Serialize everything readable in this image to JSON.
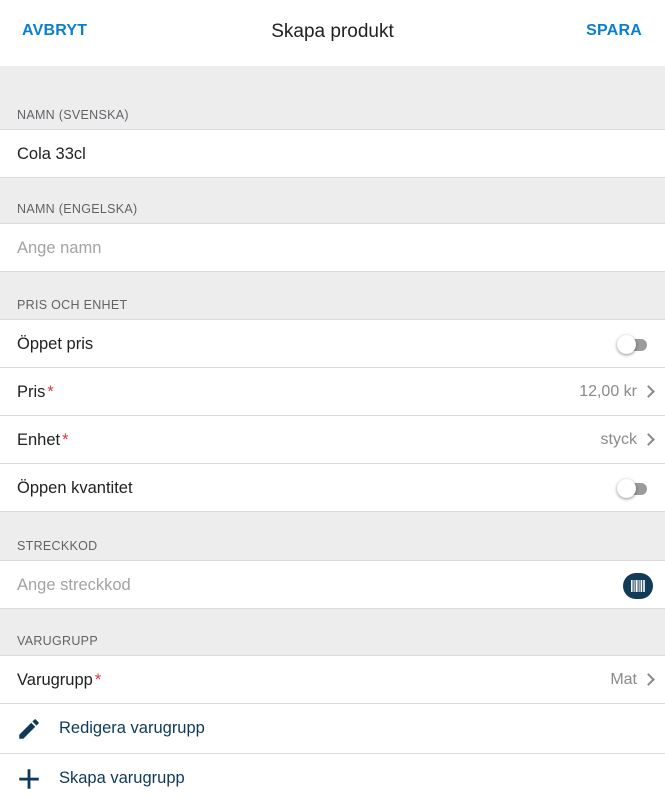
{
  "header": {
    "cancel_label": "AVBRYT",
    "title": "Skapa produkt",
    "save_label": "SPARA"
  },
  "sections": {
    "name_sv": {
      "header": "NAMN (SVENSKA)",
      "value": "Cola 33cl"
    },
    "name_en": {
      "header": "NAMN (ENGELSKA)",
      "placeholder": "Ange namn"
    },
    "price_unit": {
      "header": "PRIS OCH ENHET",
      "open_price_label": "Öppet pris",
      "open_price_on": false,
      "price_label": "Pris",
      "price_value": "12,00 kr",
      "unit_label": "Enhet",
      "unit_value": "styck",
      "open_quantity_label": "Öppen kvantitet",
      "open_quantity_on": false
    },
    "barcode": {
      "header": "STRECKKOD",
      "placeholder": "Ange streckkod"
    },
    "product_group": {
      "header": "VARUGRUPP",
      "group_label": "Varugrupp",
      "group_value": "Mat",
      "edit_label": "Redigera varugrupp",
      "create_label": "Skapa varugrupp"
    }
  },
  "required_marker": "*",
  "icons": {
    "edit": "pencil-icon",
    "create": "plus-icon",
    "barcode": "barcode-icon",
    "chevron": "chevron-right-icon"
  },
  "colors": {
    "accent": "#0a7fce",
    "required": "#e0353d",
    "dark_action": "#0d3a5a",
    "barcode_button": "#123b57",
    "section_bg": "#ededed"
  }
}
